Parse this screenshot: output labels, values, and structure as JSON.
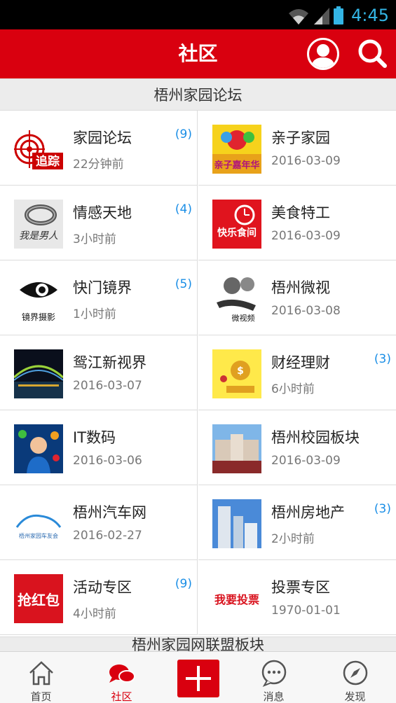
{
  "status_bar": {
    "time": "4:45"
  },
  "header": {
    "title": "社区",
    "user_icon": "user-icon",
    "search_icon": "search-icon"
  },
  "section1": {
    "title": "梧州家园论坛"
  },
  "forums": [
    {
      "name": "家园论坛",
      "time": "22分钟前",
      "count": "(9)",
      "thumb_text": "追踪",
      "thumb_icon": "target-news-logo"
    },
    {
      "name": "亲子家园",
      "time": "2016-03-09",
      "count": "",
      "thumb_text": "亲子嘉年华",
      "thumb_icon": "balloon-logo"
    },
    {
      "name": "情感天地",
      "time": "3小时前",
      "count": "(4)",
      "thumb_text": "我是男人",
      "thumb_icon": "ring-photo"
    },
    {
      "name": "美食特工",
      "time": "2016-03-09",
      "count": "",
      "thumb_text": "快乐食间",
      "thumb_icon": "clock-logo"
    },
    {
      "name": "快门镜界",
      "time": "1小时前",
      "count": "(5)",
      "thumb_text": "镜界摄影",
      "thumb_icon": "eye-logo"
    },
    {
      "name": "梧州微视",
      "time": "2016-03-08",
      "count": "",
      "thumb_text": "微视频",
      "thumb_icon": "film-reel-logo"
    },
    {
      "name": "鸳江新视界",
      "time": "2016-03-07",
      "count": "",
      "thumb_text": "",
      "thumb_icon": "bridge-night-photo"
    },
    {
      "name": "财经理财",
      "time": "6小时前",
      "count": "(3)",
      "thumb_text": "",
      "thumb_icon": "money-bag-image"
    },
    {
      "name": "IT数码",
      "time": "2016-03-06",
      "count": "",
      "thumb_text": "",
      "thumb_icon": "digital-man-image"
    },
    {
      "name": "梧州校园板块",
      "time": "2016-03-09",
      "count": "",
      "thumb_text": "",
      "thumb_icon": "campus-photo"
    },
    {
      "name": "梧州汽车网",
      "time": "2016-02-27",
      "count": "",
      "thumb_text": "梧州家园车友会",
      "thumb_icon": "car-club-logo"
    },
    {
      "name": "梧州房地产",
      "time": "2小时前",
      "count": "(3)",
      "thumb_text": "",
      "thumb_icon": "building-photo"
    },
    {
      "name": "活动专区",
      "time": "4小时前",
      "count": "(9)",
      "thumb_text": "抢红包",
      "thumb_icon": "red-envelope-logo"
    },
    {
      "name": "投票专区",
      "time": "1970-01-01",
      "count": "",
      "thumb_text": "我要投票",
      "thumb_icon": "vote-logo"
    }
  ],
  "section2": {
    "title": "梧州家园网联盟板块"
  },
  "bottom_nav": [
    {
      "label": "首页",
      "icon": "home-icon"
    },
    {
      "label": "社区",
      "icon": "community-chat-icon"
    },
    {
      "label": "",
      "icon": "plus-icon"
    },
    {
      "label": "消息",
      "icon": "message-icon"
    },
    {
      "label": "发现",
      "icon": "compass-icon"
    }
  ],
  "colors": {
    "brand_red": "#d9000f",
    "count_blue": "#1a8ee6",
    "status_blue": "#33b5e5"
  }
}
